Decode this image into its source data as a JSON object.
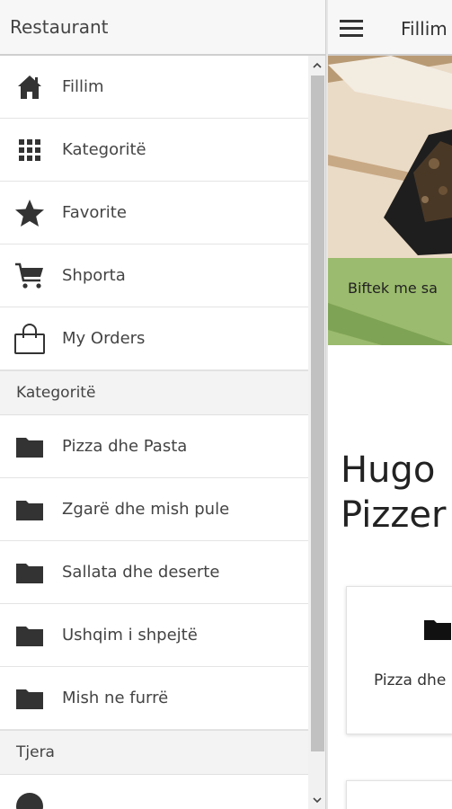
{
  "drawer": {
    "title": "Restaurant",
    "main_items": [
      {
        "label": "Fillim",
        "icon": "home-icon"
      },
      {
        "label": "Kategoritë",
        "icon": "grid-icon"
      },
      {
        "label": "Favorite",
        "icon": "star-icon"
      },
      {
        "label": "Shporta",
        "icon": "cart-icon"
      },
      {
        "label": "My Orders",
        "icon": "bag-icon"
      }
    ],
    "categories_header": "Kategoritë",
    "categories": [
      {
        "label": "Pizza dhe Pasta",
        "icon": "folder-icon"
      },
      {
        "label": "Zgarë dhe mish pule",
        "icon": "folder-icon"
      },
      {
        "label": "Sallata dhe deserte",
        "icon": "folder-icon"
      },
      {
        "label": "Ushqim i shpejtë",
        "icon": "folder-icon"
      },
      {
        "label": "Mish ne furrë",
        "icon": "folder-icon"
      }
    ],
    "other_header": "Tjera"
  },
  "app": {
    "title": "Fillim",
    "banner_caption": "Biftek me sa",
    "heading_line1": "Hugo",
    "heading_line2": "Pizzer",
    "card_label": "Pizza dhe"
  },
  "colors": {
    "caption_bg": "#9bbb6e",
    "header_bg": "#f7f7f7"
  }
}
